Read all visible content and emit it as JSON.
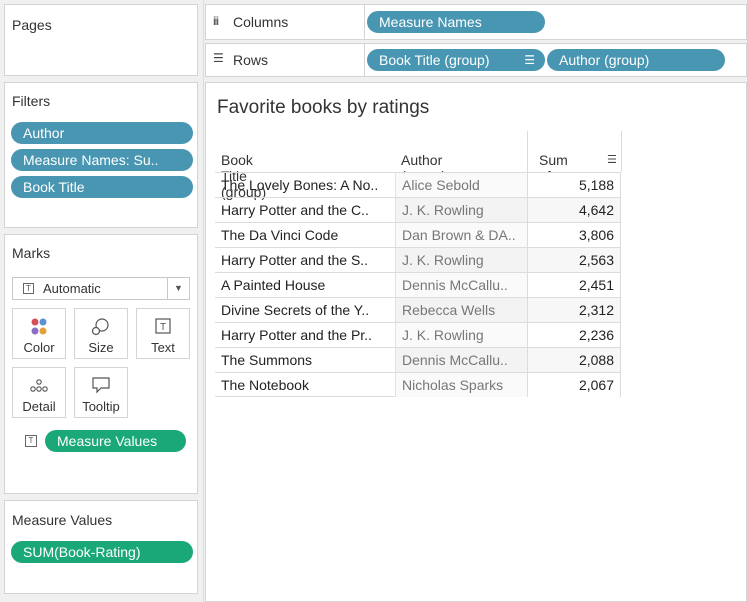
{
  "pages": {
    "title": "Pages"
  },
  "filters": {
    "title": "Filters",
    "items": [
      "Author",
      "Measure Names: Su..",
      "Book Title"
    ]
  },
  "marks": {
    "title": "Marks",
    "type": "Automatic",
    "buttons": [
      "Color",
      "Size",
      "Text",
      "Detail",
      "Tooltip"
    ],
    "field": "Measure Values"
  },
  "measure_values": {
    "title": "Measure Values",
    "items": [
      "SUM(Book-Rating)"
    ]
  },
  "shelves": {
    "columns_label": "Columns",
    "columns_pill": "Measure Names",
    "rows_label": "Rows",
    "rows_pills": [
      "Book Title (group)",
      "Author (group)"
    ]
  },
  "viz": {
    "title": "Favorite books by ratings",
    "headers": [
      "Book Title (group)",
      "Author (group)",
      "Sum of .."
    ],
    "rows": [
      {
        "title": "The Lovely Bones: A No..",
        "author": "Alice Sebold",
        "value": "5,188"
      },
      {
        "title": "Harry Potter and the C..",
        "author": "J. K. Rowling",
        "value": "4,642"
      },
      {
        "title": "The Da Vinci Code",
        "author": "Dan Brown & DA..",
        "value": "3,806"
      },
      {
        "title": "Harry Potter and the S..",
        "author": "J. K. Rowling",
        "value": "2,563"
      },
      {
        "title": "A Painted House",
        "author": "Dennis McCallu..",
        "value": "2,451"
      },
      {
        "title": "Divine Secrets of the Y..",
        "author": "Rebecca Wells",
        "value": "2,312"
      },
      {
        "title": "Harry Potter and the Pr..",
        "author": "J. K. Rowling",
        "value": "2,236"
      },
      {
        "title": "The Summons",
        "author": "Dennis McCallu..",
        "value": "2,088"
      },
      {
        "title": "The Notebook",
        "author": "Nicholas Sparks",
        "value": "2,067"
      }
    ]
  },
  "colors": {
    "blue_pill": "#4996b2",
    "green_pill": "#1aa879"
  }
}
